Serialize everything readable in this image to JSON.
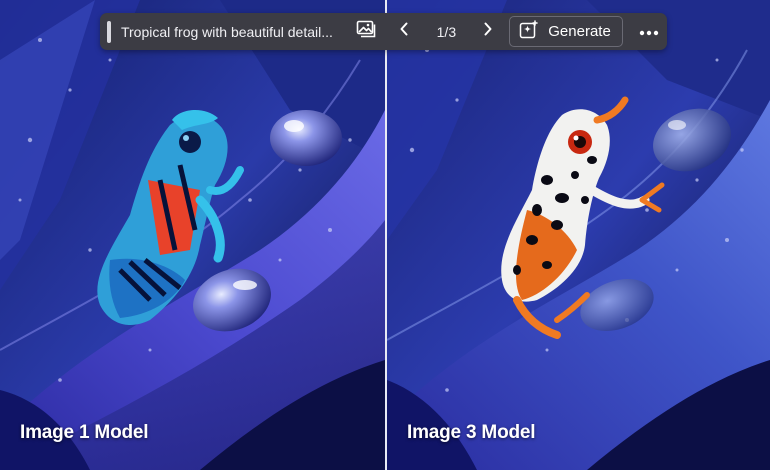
{
  "toolbar": {
    "prompt": "Tropical frog with beautiful detail...",
    "counter": "1/3",
    "generate_label": "Generate",
    "icons": {
      "image": "image-icon",
      "prev": "chevron-left-icon",
      "next": "chevron-right-icon",
      "generate": "sparkle-icon",
      "more": "more-horizontal-icon"
    }
  },
  "panels": [
    {
      "caption": "Image 1 Model"
    },
    {
      "caption": "Image 3 Model"
    }
  ],
  "colors": {
    "toolbar_bg": "#3c3c44",
    "background_blue": "#1a2a8a",
    "leaf_violet": "#4a3ab5"
  }
}
